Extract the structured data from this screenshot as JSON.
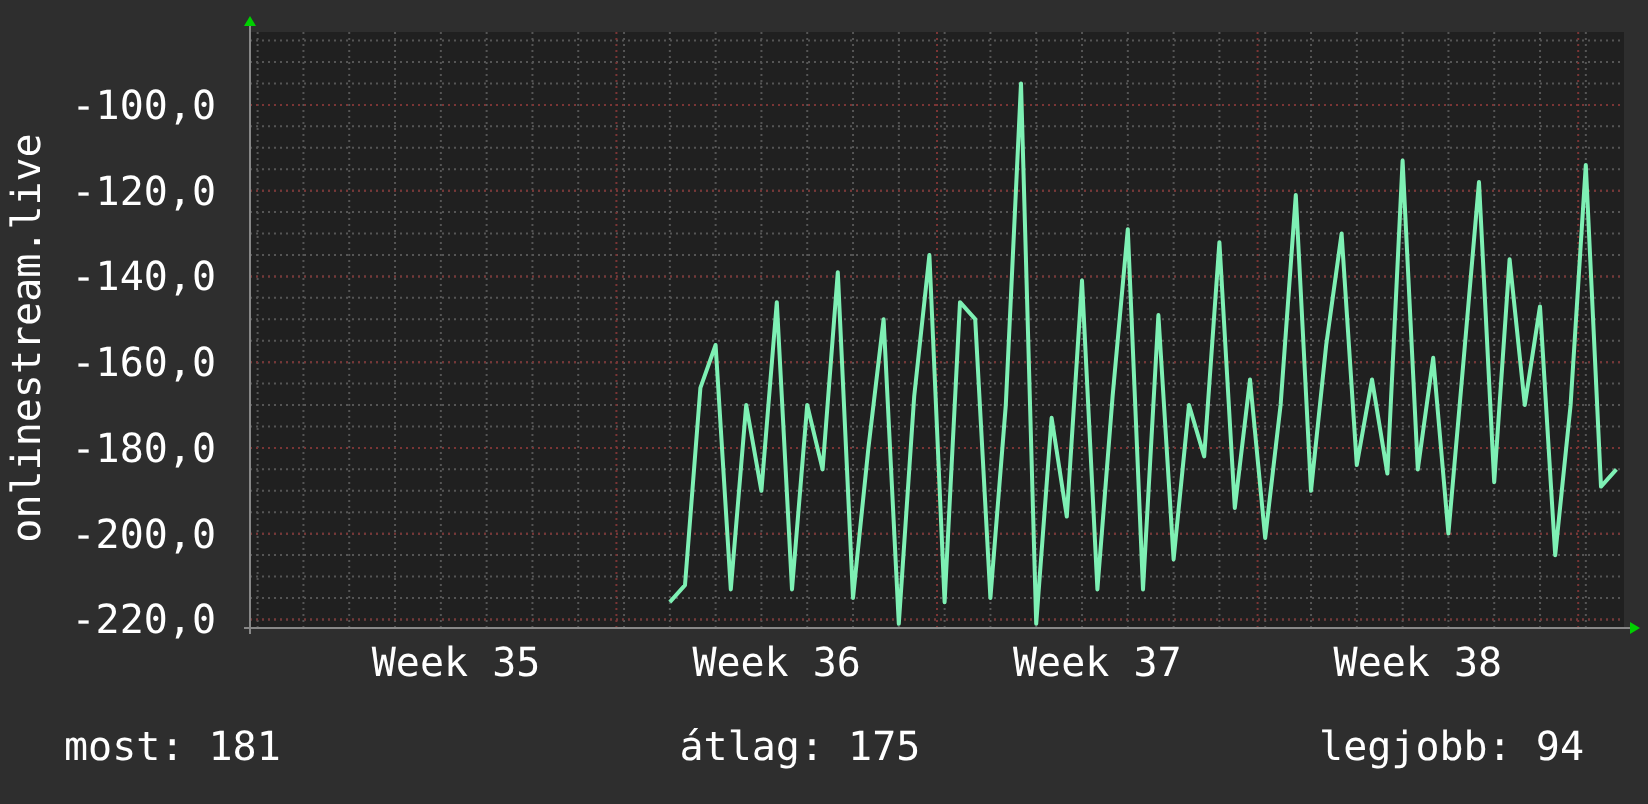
{
  "chart": {
    "chart_data": {
      "type": "line",
      "ylabel": "onlinestream.live",
      "ylim": [
        -222,
        -83
      ],
      "grid": true,
      "yticks": [
        {
          "value": -100,
          "label": "-100,0"
        },
        {
          "value": -120,
          "label": "-120,0"
        },
        {
          "value": -140,
          "label": "-140,0"
        },
        {
          "value": -160,
          "label": "-160,0"
        },
        {
          "value": -180,
          "label": "-180,0"
        },
        {
          "value": -200,
          "label": "-200,0"
        },
        {
          "value": -220,
          "label": "-220,0"
        }
      ],
      "categories": [
        null,
        null,
        null,
        null,
        null,
        null,
        null,
        null,
        null,
        null,
        null,
        null,
        null,
        "Week 35",
        null,
        null,
        null,
        null,
        null,
        null,
        null,
        null,
        null,
        null,
        null,
        null,
        null,
        null,
        null,
        null,
        null,
        null,
        null,
        null,
        "Week 36",
        null,
        null,
        null,
        null,
        null,
        null,
        null,
        null,
        null,
        null,
        null,
        null,
        null,
        null,
        null,
        null,
        null,
        null,
        null,
        null,
        "Week 37",
        null,
        null,
        null,
        null,
        null,
        null,
        null,
        null,
        null,
        null,
        null,
        null,
        null,
        null,
        null,
        null,
        null,
        null,
        null,
        null,
        "Week 38",
        null,
        null,
        null,
        null,
        null,
        null,
        null,
        null,
        null,
        null,
        null,
        null,
        null
      ],
      "series": [
        {
          "color": "#7ef0b4",
          "values": [
            null,
            null,
            null,
            null,
            null,
            null,
            null,
            null,
            null,
            null,
            null,
            null,
            null,
            null,
            null,
            null,
            null,
            null,
            null,
            null,
            null,
            null,
            null,
            null,
            null,
            null,
            null,
            -216,
            -212,
            -166,
            -156,
            -213,
            -170,
            -190,
            -146,
            -213,
            -170,
            -185,
            -139,
            -215,
            -180,
            -150,
            -221,
            -168,
            -135,
            -216,
            -146,
            -150,
            -215,
            -170,
            -95,
            -221,
            -173,
            -196,
            -141,
            -213,
            -168,
            -129,
            -213,
            -149,
            -206,
            -170,
            -182,
            -132,
            -194,
            -164,
            -201,
            -170,
            -121,
            -190,
            -156,
            -130,
            -184,
            -164,
            -186,
            -113,
            -185,
            -159,
            -200,
            -159,
            -118,
            -188,
            -136,
            -170,
            -147,
            -205,
            -170,
            -114,
            -189,
            -185
          ]
        }
      ]
    }
  },
  "stats": [
    {
      "label": "most: 181"
    },
    {
      "label": "átlag: 175"
    },
    {
      "label": "legjobb: 94"
    }
  ]
}
